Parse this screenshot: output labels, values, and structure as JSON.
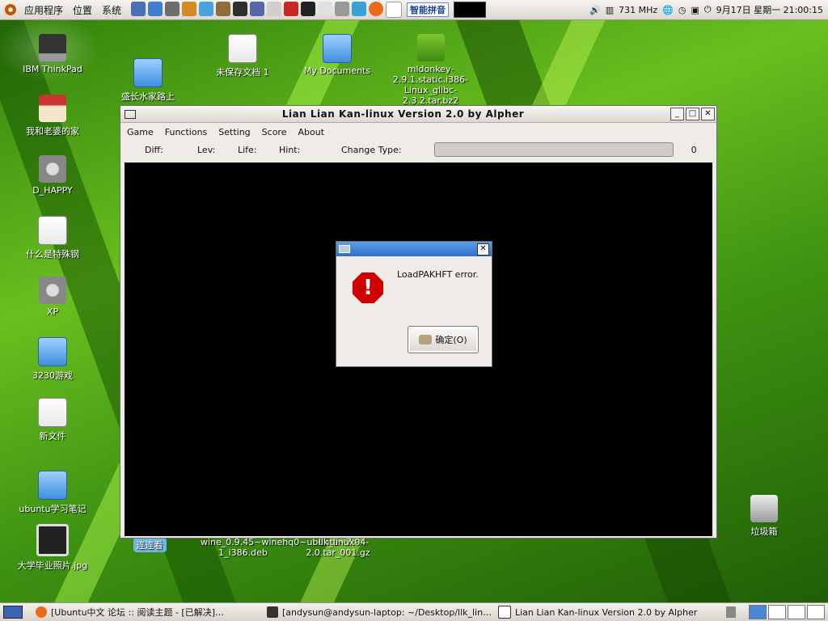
{
  "top_panel": {
    "menus": [
      "应用程序",
      "位置",
      "系统"
    ],
    "ime_label": "智能拼音",
    "cpu_freq": "731 MHz",
    "clock": "9月17日 星期一 21:00:15"
  },
  "desktop_icons": [
    {
      "label": "IBM ThinkPad"
    },
    {
      "label": "盛长水家路上"
    },
    {
      "label": "未保存文档 1"
    },
    {
      "label": "My Documents"
    },
    {
      "label": "mldonkey-2.9.1.static.i386-Linux_glibc-2.3.2.tar.bz2"
    },
    {
      "label": "我和老婆的家"
    },
    {
      "label": "D_HAPPY"
    },
    {
      "label": "什么是特殊钢"
    },
    {
      "label": "XP"
    },
    {
      "label": "3230游戏"
    },
    {
      "label": "新文件"
    },
    {
      "label": "ubuntu学习笔记"
    },
    {
      "label": "大学毕业照片.jpg"
    },
    {
      "label": "连连看"
    },
    {
      "label": "wine_0.9.45~winehq0~ubuntu~7.04-1_i386.deb"
    },
    {
      "label": "llk_linux-2.0.tar_001.gz"
    },
    {
      "label": "垃圾箱"
    }
  ],
  "game_window": {
    "title": "Lian Lian Kan-linux Version 2.0 by Alpher",
    "menus": [
      "Game",
      "Functions",
      "Setting",
      "Score",
      "About"
    ],
    "status": {
      "diff": "Diff:",
      "lev": "Lev:",
      "life": "Life:",
      "hint": "Hint:",
      "change_type": "Change Type:",
      "progress_value": "0"
    }
  },
  "dialog": {
    "message": "LoadPAKHFT error.",
    "ok_label": "确定(O)"
  },
  "taskbar": {
    "tasks": [
      "[Ubuntu中文 论坛 :: 阅读主题 - [已解决]…",
      "[andysun@andysun-laptop: ~/Desktop/llk_lin…",
      "Lian Lian Kan-linux Version 2.0 by Alpher"
    ]
  }
}
